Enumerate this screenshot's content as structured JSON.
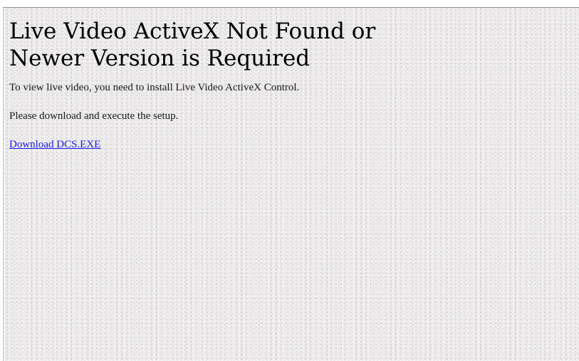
{
  "page": {
    "heading_line1": "Live Video ActiveX Not Found or",
    "heading_line2": "Newer Version is Required",
    "instruction": "To view live video, you need to install Live Video ActiveX Control.",
    "setup_note": "Please download and execute the setup.",
    "download_link_label": "Download DCS.EXE"
  },
  "colors": {
    "background": "#eceaea",
    "text": "#000000",
    "link": "#1a1aee",
    "top_border": "#8f8f8f"
  }
}
